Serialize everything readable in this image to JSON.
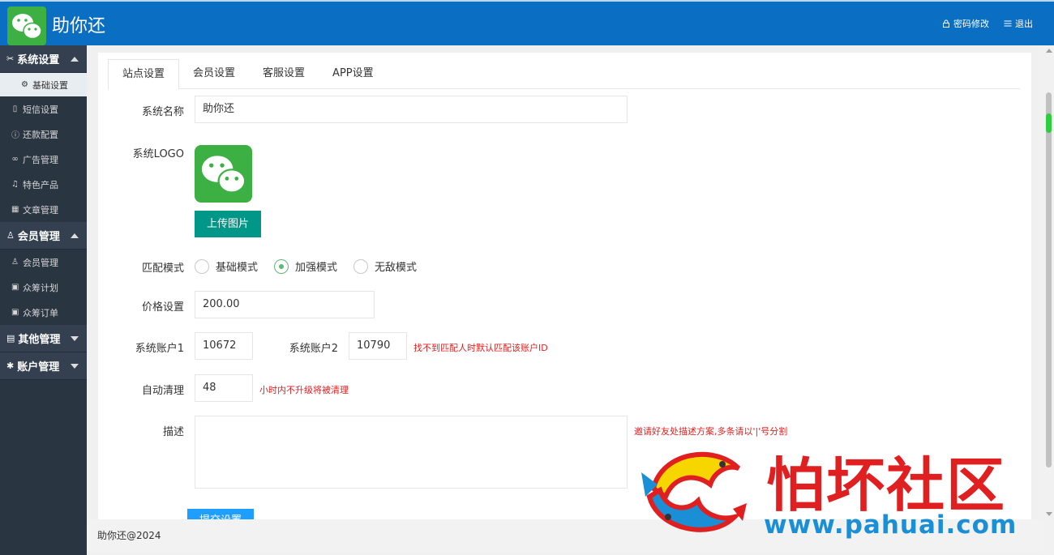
{
  "header": {
    "title": "助你还",
    "links": [
      {
        "label": "密码修改",
        "icon": "lock-icon"
      },
      {
        "label": "退出",
        "icon": "menu-icon"
      }
    ]
  },
  "sidebar": {
    "groups": [
      {
        "label": "系统设置",
        "icon": "tools-icon",
        "expanded": true,
        "items": [
          {
            "label": "基础设置",
            "icon": "gear-icon",
            "active": true
          },
          {
            "label": "短信设置",
            "icon": "phone-icon"
          },
          {
            "label": "还款配置",
            "icon": "info-circle-icon"
          },
          {
            "label": "广告管理",
            "icon": "link-icon"
          },
          {
            "label": "特色产品",
            "icon": "bell-icon"
          },
          {
            "label": "文章管理",
            "icon": "grid-icon"
          }
        ]
      },
      {
        "label": "会员管理",
        "icon": "user-icon",
        "expanded": true,
        "items": [
          {
            "label": "会员管理",
            "icon": "user-icon"
          },
          {
            "label": "众筹计划",
            "icon": "apps-icon"
          },
          {
            "label": "众筹订单",
            "icon": "apps-icon"
          }
        ]
      },
      {
        "label": "其他管理",
        "icon": "book-icon",
        "expanded": false,
        "items": []
      },
      {
        "label": "账户管理",
        "icon": "gear-icon",
        "expanded": false,
        "items": []
      }
    ]
  },
  "tabs": [
    "站点设置",
    "会员设置",
    "客服设置",
    "APP设置"
  ],
  "form": {
    "system_name": {
      "label": "系统名称",
      "value": "助你还"
    },
    "system_logo": {
      "label": "系统LOGO",
      "upload_label": "上传图片"
    },
    "match_mode": {
      "label": "匹配模式",
      "options": [
        "基础模式",
        "加强模式",
        "无敌模式"
      ],
      "selected": "加强模式"
    },
    "price": {
      "label": "价格设置",
      "value": "200.00"
    },
    "account1": {
      "label": "系统账户1",
      "value": "10672"
    },
    "account2": {
      "label": "系统账户2",
      "value": "10790",
      "hint": "找不到匹配人时默认匹配该账户ID"
    },
    "auto_clean": {
      "label": "自动清理",
      "value": "48",
      "hint": "小时内不升级将被清理"
    },
    "description": {
      "label": "描述",
      "value": "",
      "hint": "邀请好友处描述方案,多条请以'|'号分割"
    },
    "submit_label": "提交设置"
  },
  "footer": {
    "text": "助你还@2024"
  },
  "watermark": {
    "text": "怕坏社区",
    "url": "www.pahuai.com"
  },
  "colors": {
    "header": "#0a6fc2",
    "sidebar": "#2a3542",
    "upload_button": "#009688",
    "submit_button": "#1e9fff",
    "hint": "#e02020",
    "radio_on": "#5fb878"
  }
}
